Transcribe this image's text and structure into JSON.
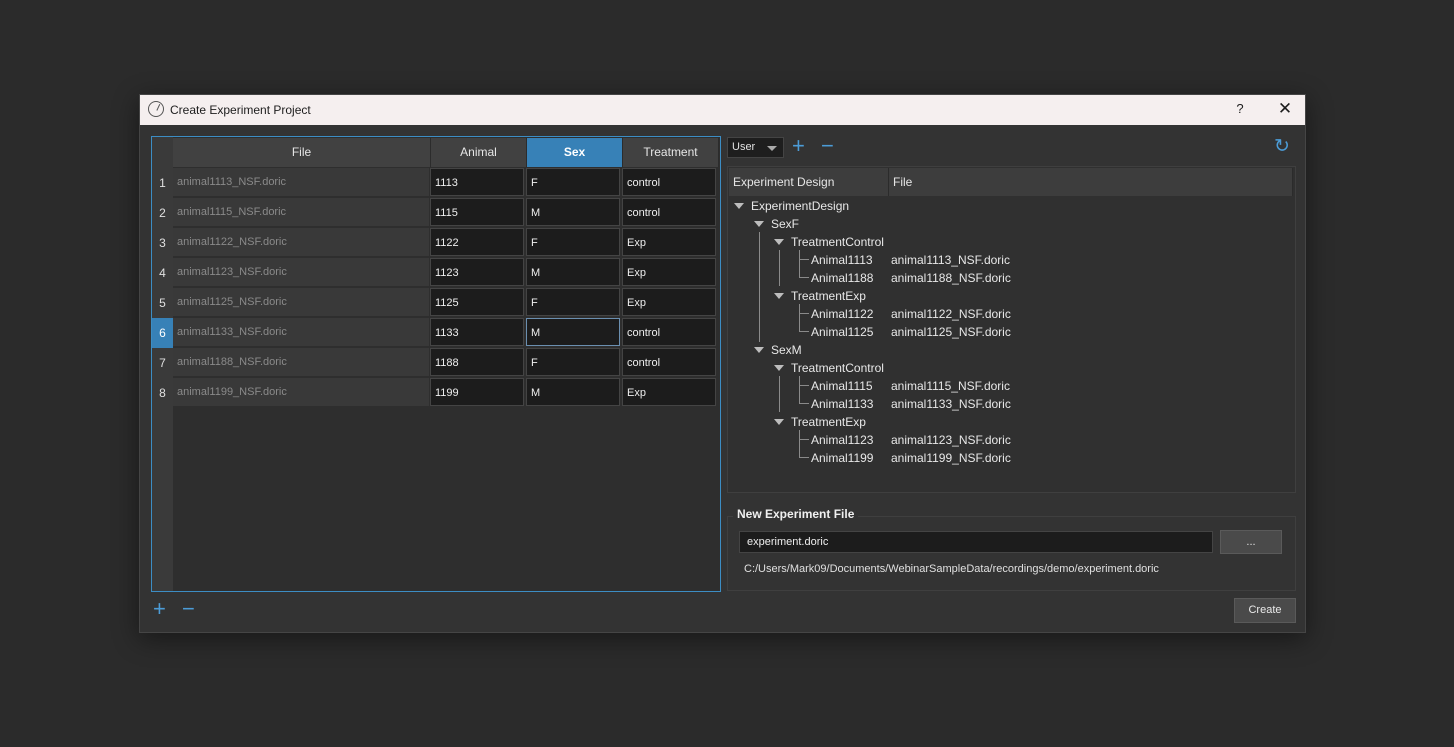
{
  "window": {
    "title": "Create Experiment Project",
    "help": "?",
    "close": "✕"
  },
  "table": {
    "headers": [
      "File",
      "Animal",
      "Sex",
      "Treatment"
    ],
    "active_header": "Sex",
    "active_row": 6,
    "rows": [
      {
        "num": "1",
        "file": "animal1113_NSF.doric",
        "animal": "1113",
        "sex": "F",
        "treatment": "control"
      },
      {
        "num": "2",
        "file": "animal1115_NSF.doric",
        "animal": "1115",
        "sex": "M",
        "treatment": "control"
      },
      {
        "num": "3",
        "file": "animal1122_NSF.doric",
        "animal": "1122",
        "sex": "F",
        "treatment": "Exp"
      },
      {
        "num": "4",
        "file": "animal1123_NSF.doric",
        "animal": "1123",
        "sex": "M",
        "treatment": "Exp"
      },
      {
        "num": "5",
        "file": "animal1125_NSF.doric",
        "animal": "1125",
        "sex": "F",
        "treatment": "Exp"
      },
      {
        "num": "6",
        "file": "animal1133_NSF.doric",
        "animal": "1133",
        "sex": "M",
        "treatment": "control"
      },
      {
        "num": "7",
        "file": "animal1188_NSF.doric",
        "animal": "1188",
        "sex": "F",
        "treatment": "control"
      },
      {
        "num": "8",
        "file": "animal1199_NSF.doric",
        "animal": "1199",
        "sex": "M",
        "treatment": "Exp"
      }
    ],
    "add_icon": "+",
    "remove_icon": "−"
  },
  "design": {
    "mode": "User",
    "add_icon": "+",
    "remove_icon": "−",
    "refresh_icon": "↻",
    "columns": [
      "Experiment Design",
      "File"
    ],
    "tree": {
      "root": "ExperimentDesign",
      "sexF": "SexF",
      "sexF_control": "TreatmentControl",
      "a1113": "Animal1113",
      "f1113": "animal1113_NSF.doric",
      "a1188": "Animal1188",
      "f1188": "animal1188_NSF.doric",
      "sexF_exp": "TreatmentExp",
      "a1122": "Animal1122",
      "f1122": "animal1122_NSF.doric",
      "a1125": "Animal1125",
      "f1125": "animal1125_NSF.doric",
      "sexM": "SexM",
      "sexM_control": "TreatmentControl",
      "a1115": "Animal1115",
      "f1115": "animal1115_NSF.doric",
      "a1133": "Animal1133",
      "f1133": "animal1133_NSF.doric",
      "sexM_exp": "TreatmentExp",
      "a1123": "Animal1123",
      "f1123": "animal1123_NSF.doric",
      "a1199": "Animal1199",
      "f1199": "animal1199_NSF.doric"
    }
  },
  "new_file": {
    "title": "New Experiment File",
    "name": "experiment.doric",
    "browse_label": "...",
    "path": "C:/Users/Mark09/Documents/WebinarSampleData/recordings/demo/experiment.doric"
  },
  "create_label": "Create"
}
